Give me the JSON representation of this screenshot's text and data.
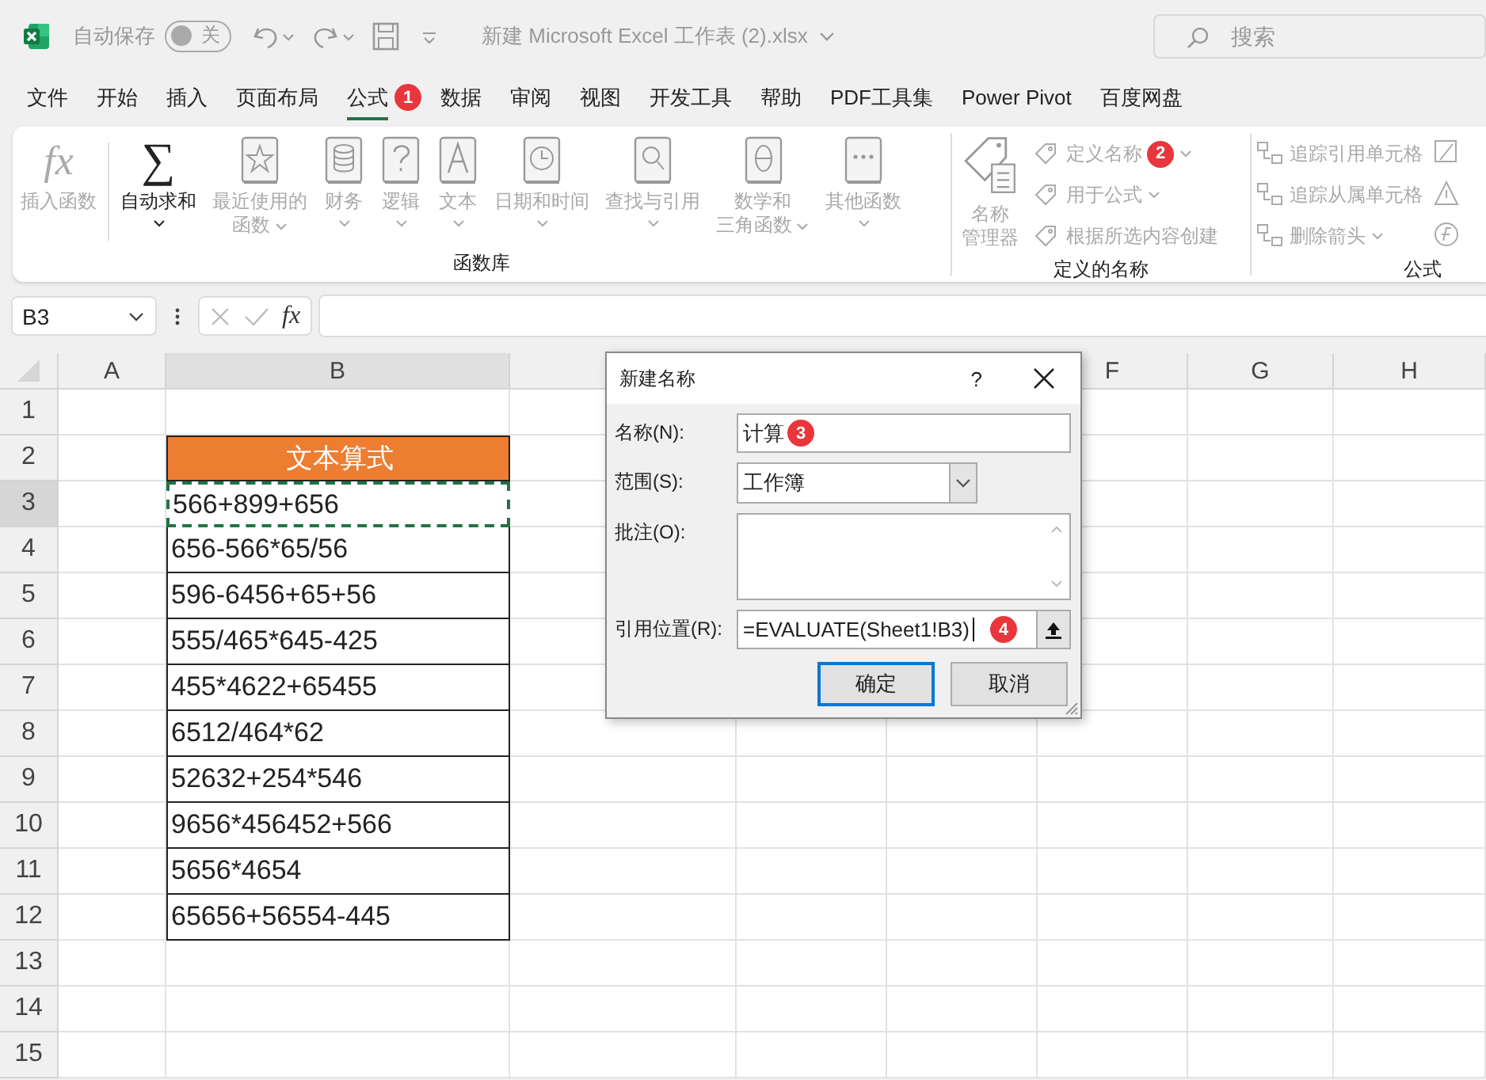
{
  "title_bar": {
    "autosave_label": "自动保存",
    "autosave": {
      "on": false,
      "label": "关"
    },
    "title": "新建 Microsoft Excel 工作表 (2).xlsx",
    "search": {
      "placeholder": "搜索"
    }
  },
  "tabs": [
    {
      "label": "文件",
      "selected": false
    },
    {
      "label": "开始",
      "selected": false
    },
    {
      "label": "插入",
      "selected": false
    },
    {
      "label": "页面布局",
      "selected": false
    },
    {
      "label": "公式",
      "selected": true,
      "badge": "1"
    },
    {
      "label": "数据",
      "selected": false
    },
    {
      "label": "审阅",
      "selected": false
    },
    {
      "label": "视图",
      "selected": false
    },
    {
      "label": "开发工具",
      "selected": false
    },
    {
      "label": "帮助",
      "selected": false
    },
    {
      "label": "PDF工具集",
      "selected": false
    },
    {
      "label": "Power Pivot",
      "selected": false
    },
    {
      "label": "百度网盘",
      "selected": false
    }
  ],
  "ribbon": {
    "groups": [
      {
        "title": "函数库",
        "items": [
          {
            "kind": "char",
            "icon_char": "fx",
            "lines": [
              "插入函数"
            ],
            "disabled": true,
            "dropdown": false
          },
          {
            "kind": "char",
            "icon_char": "∑",
            "lines": [
              "自动求和"
            ],
            "disabled": false,
            "dropdown": true
          },
          {
            "kind": "book",
            "lines": [
              "最近使用的",
              "函数"
            ],
            "disabled": true,
            "dropdown": true
          },
          {
            "kind": "book",
            "lines": [
              "财务"
            ],
            "disabled": true,
            "dropdown": true
          },
          {
            "kind": "book",
            "lines": [
              "逻辑"
            ],
            "disabled": true,
            "dropdown": true
          },
          {
            "kind": "book",
            "lines": [
              "文本"
            ],
            "disabled": true,
            "dropdown": true
          },
          {
            "kind": "book",
            "lines": [
              "日期和时间"
            ],
            "disabled": true,
            "dropdown": true
          },
          {
            "kind": "book",
            "lines": [
              "查找与引用"
            ],
            "disabled": true,
            "dropdown": true
          },
          {
            "kind": "book",
            "lines": [
              "数学和",
              "三角函数"
            ],
            "disabled": true,
            "dropdown": true
          },
          {
            "kind": "book",
            "lines": [
              "其他函数"
            ],
            "disabled": true,
            "dropdown": true
          }
        ]
      },
      {
        "title": "定义的名称",
        "items": [
          {
            "kind": "large",
            "lines": [
              "名称",
              "管理器"
            ],
            "disabled": true,
            "dropdown": false
          },
          {
            "kind": "small",
            "lines": [
              "定义名称"
            ],
            "disabled": true,
            "dropdown": true,
            "badge": "2"
          },
          {
            "kind": "small",
            "lines": [
              "用于公式"
            ],
            "disabled": true,
            "dropdown": true
          },
          {
            "kind": "small",
            "lines": [
              "根据所选内容创建"
            ],
            "disabled": true,
            "dropdown": false
          }
        ]
      },
      {
        "title": "公式",
        "items": [
          {
            "kind": "small",
            "lines": [
              "追踪引用单元格"
            ],
            "disabled": true,
            "dropdown": false
          },
          {
            "kind": "small",
            "lines": [
              "追踪从属单元格"
            ],
            "disabled": true,
            "dropdown": false
          },
          {
            "kind": "small",
            "lines": [
              "删除箭头"
            ],
            "disabled": true,
            "dropdown": true
          },
          {
            "kind": "iconcol",
            "disabled": true
          }
        ]
      }
    ]
  },
  "formula_bar": {
    "name_box": "B3",
    "fx": "fx"
  },
  "columns": [
    {
      "label": "A"
    },
    {
      "label": "B"
    },
    {},
    {},
    {},
    {
      "label": "F"
    },
    {
      "label": "G"
    },
    {
      "label": "H"
    }
  ],
  "rows": [
    {
      "number": "1"
    },
    {
      "number": "2",
      "b": {
        "kind": "header",
        "text": "文本算式",
        "selected": false
      }
    },
    {
      "number": "3",
      "b": {
        "kind": "data",
        "text": "566+899+656",
        "selected": true
      }
    },
    {
      "number": "4",
      "b": {
        "kind": "data",
        "text": "656-566*65/56",
        "selected": false
      }
    },
    {
      "number": "5",
      "b": {
        "kind": "data",
        "text": "596-6456+65+56",
        "selected": false
      }
    },
    {
      "number": "6",
      "b": {
        "kind": "data",
        "text": "555/465*645-425",
        "selected": false
      }
    },
    {
      "number": "7",
      "b": {
        "kind": "data",
        "text": "455*4622+65455",
        "selected": false
      }
    },
    {
      "number": "8",
      "b": {
        "kind": "data",
        "text": "6512/464*62",
        "selected": false
      }
    },
    {
      "number": "9",
      "b": {
        "kind": "data",
        "text": "52632+254*546",
        "selected": false
      }
    },
    {
      "number": "10",
      "b": {
        "kind": "data",
        "text": "9656*456452+566",
        "selected": false
      }
    },
    {
      "number": "11",
      "b": {
        "kind": "data",
        "text": "5656*4654",
        "selected": false
      }
    },
    {
      "number": "12",
      "b": {
        "kind": "data",
        "text": "65656+56554-445",
        "selected": false
      }
    },
    {
      "number": "13"
    },
    {
      "number": "14"
    },
    {
      "number": "15"
    }
  ],
  "dialog": {
    "title": "新建名称",
    "help": "?",
    "fields": [
      {
        "kind": "text",
        "label": "名称(N):",
        "value": "计算",
        "badge": "3"
      },
      {
        "kind": "select",
        "label": "范围(S):",
        "value": "工作簿"
      },
      {
        "kind": "textarea",
        "label": "批注(O):"
      },
      {
        "kind": "ref",
        "label": "引用位置(R):",
        "value": "=EVALUATE(Sheet1!B3)",
        "badge": "4"
      }
    ],
    "buttons": [
      {
        "label": "确定",
        "default": true
      },
      {
        "label": "取消",
        "default": false
      }
    ]
  }
}
